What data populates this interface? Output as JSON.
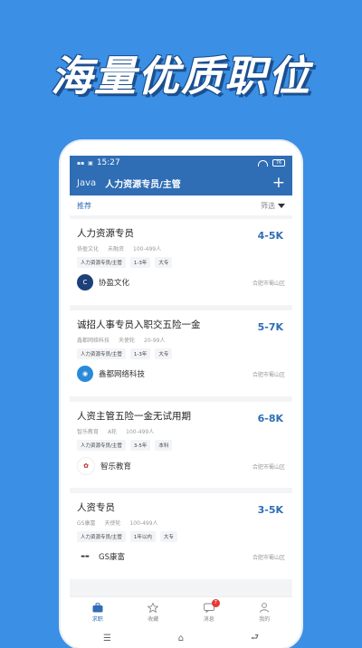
{
  "banner": {
    "text": "海量优质职位"
  },
  "status": {
    "time": "15:27",
    "battery": "76"
  },
  "navbar": {
    "lang": "Java",
    "title": "人力资源专员/主管",
    "add_icon": "plus-icon"
  },
  "filter": {
    "tab": "推荐",
    "sort": "筛选"
  },
  "jobs": [
    {
      "title": "人力资源专员",
      "salary": "4-5K",
      "company_short": "协盈文化",
      "stage": "未融资",
      "size": "100-499人",
      "tags": [
        "人力资源专员/主管",
        "1-3年",
        "大专"
      ],
      "company": "协盈文化",
      "area": "合肥市蜀山区"
    },
    {
      "title": "诚招人事专员入职交五险一金",
      "salary": "5-7K",
      "company_short": "鑫都网络科技",
      "stage": "天使轮",
      "size": "20-99人",
      "tags": [
        "人力资源专员/主管",
        "1-3年",
        "大专"
      ],
      "company": "鑫都网络科技",
      "area": "合肥市蜀山区"
    },
    {
      "title": "人资主管五险一金无试用期",
      "salary": "6-8K",
      "company_short": "智乐教育",
      "stage": "A轮",
      "size": "100-499人",
      "tags": [
        "人力资源专员/主管",
        "3-5年",
        "本科"
      ],
      "company": "智乐教育",
      "area": "合肥市蜀山区"
    },
    {
      "title": "人资专员",
      "salary": "3-5K",
      "company_short": "GS康富",
      "stage": "天使轮",
      "size": "100-499人",
      "tags": [
        "人力资源专员/主管",
        "1年以内",
        "大专"
      ],
      "company": "GS康富",
      "area": "合肥市蜀山区"
    }
  ],
  "tabs": [
    {
      "label": "求职",
      "icon": "briefcase-icon"
    },
    {
      "label": "收藏",
      "icon": "star-icon"
    },
    {
      "label": "消息",
      "icon": "message-icon",
      "badge": "7"
    },
    {
      "label": "我的",
      "icon": "user-icon"
    }
  ],
  "colors": {
    "brand": "#2f6db5",
    "background": "#3b8fe4"
  }
}
